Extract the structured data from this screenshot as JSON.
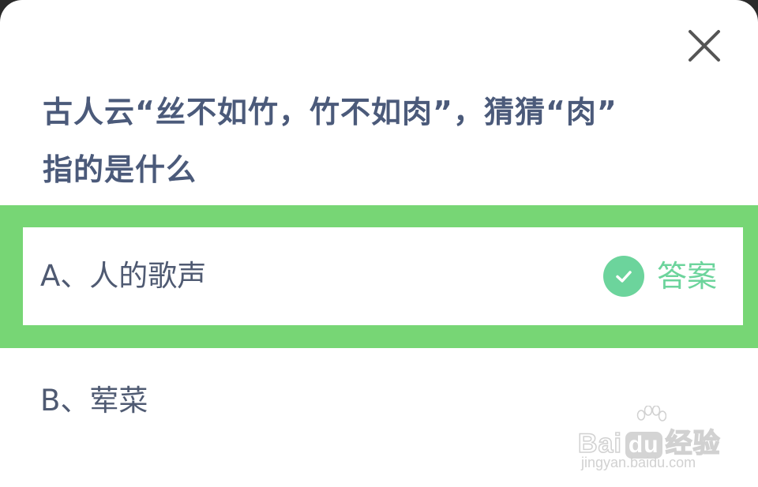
{
  "question": {
    "line1": "古人云“丝不如竹，竹不如肉”，猜猜“肉”",
    "line2": "指的是什么"
  },
  "options": [
    {
      "label": "A、人的歌声",
      "answer_label": "答案",
      "highlighted": true
    },
    {
      "label": "B、荤菜"
    }
  ],
  "watermark": {
    "brand_left": "Bai",
    "brand_right": "经验",
    "domain": "jingyan.baidu.com"
  },
  "colors": {
    "highlight": "#77d675",
    "correct": "#6cd49c",
    "question_text": "#4b5a7a"
  },
  "icons": {
    "close": "close-icon",
    "check": "check-icon"
  }
}
